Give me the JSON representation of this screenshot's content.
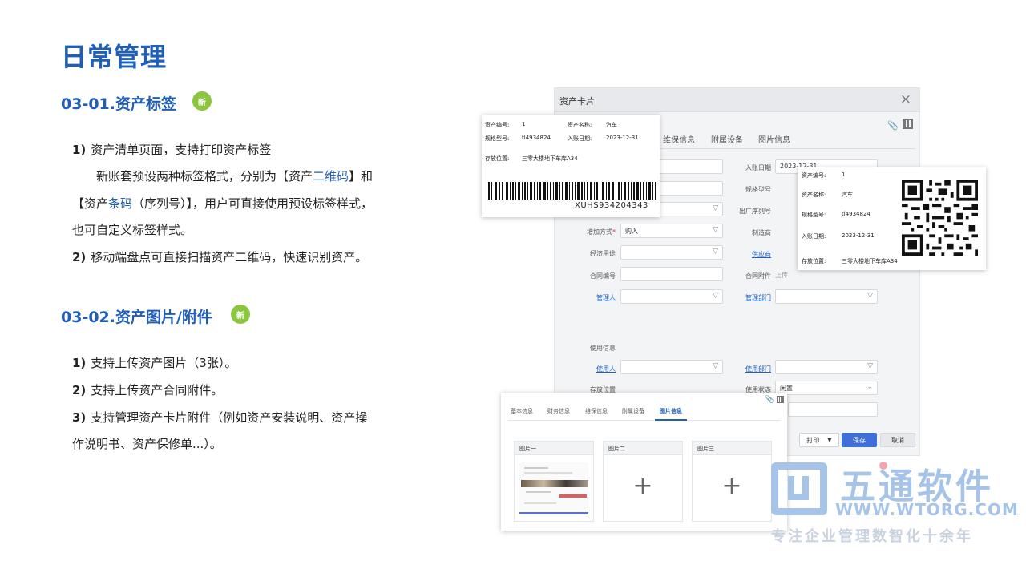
{
  "page": {
    "title": "日常管理",
    "sections": [
      {
        "title": "03-01.资产标签",
        "badge": "新",
        "lines": {
          "l1_num": "1)",
          "l1_text": "资产清单页面，支持打印资产标签",
          "l2_a": "新账套预设两种标签格式，分别为【资产",
          "l2_link": "二维码",
          "l2_b": "】和",
          "l3_a": "【资产",
          "l3_link": "条码",
          "l3_b": "（序列号）】，用户可直接使用预设标签样式，",
          "l4": "也可自定义标签样式。",
          "l5_num": "2)",
          "l5_text": "移动端盘点可直接扫描资产二维码，快速识别资产。"
        }
      },
      {
        "title": "03-02.资产图片/附件",
        "badge": "新",
        "lines": {
          "l1_num": "1)",
          "l1_text": "支持上传资产图片（3张）。",
          "l2_num": "2)",
          "l2_text": "支持上传资产合同附件。",
          "l3_num": "3)",
          "l3_text": "支持管理资产卡片附件（例如资产安装说明、资产操",
          "l4": "作说明书、资产保修单...）。"
        }
      }
    ]
  },
  "dialog": {
    "title": "资产卡片",
    "close": "×",
    "tabs": [
      "维保信息",
      "附属设备",
      "图片信息"
    ],
    "fields": {
      "entry_date_label": "入账日期",
      "entry_date_value": "2023-12-31",
      "spec_label": "规格型号",
      "serial_label": "出厂序列号",
      "add_method_label": "增加方式",
      "add_method_value": "购入",
      "maker_label": "制造商",
      "econ_use_label": "经济用途",
      "supplier_label": "供应商",
      "contract_no_label": "合同编号",
      "contract_attach_label": "合同附件",
      "upload": "上传",
      "manager_label": "管理人",
      "mgmt_dept_label": "管理部门",
      "usage_section": "使用信息",
      "user_label": "使用人",
      "use_dept_label": "使用部门",
      "location_label": "存放位置",
      "use_status_label": "使用状态",
      "use_status_value": "闲置"
    },
    "buttons": {
      "print": "打印",
      "save": "保存",
      "cancel": "取消"
    }
  },
  "barcode_label": {
    "asset_no_label": "资产编号:",
    "asset_no_value": "1",
    "asset_name_label": "资产名称:",
    "asset_name_value": "汽车",
    "spec_label": "规格型号:",
    "spec_value": "tl4934824",
    "date_label": "入账日期:",
    "date_value": "2023-12-31",
    "location_label": "存放位置:",
    "location_value": "三零大楼地下车库A34",
    "barcode_text": "XUHS934204343"
  },
  "qr_label": {
    "asset_no_label": "资产编号:",
    "asset_no_value": "1",
    "asset_name_label": "资产名称:",
    "asset_name_value": "汽车",
    "spec_label": "规格型号:",
    "spec_value": "tl4934824",
    "date_label": "入账日期:",
    "date_value": "2023-12-31",
    "location_label": "存放位置:",
    "location_value": "三零大楼地下车库A34"
  },
  "photo_panel": {
    "tabs": [
      "基本信息",
      "财务信息",
      "维保信息",
      "附属设备",
      "图片信息"
    ],
    "active_tab": "图片信息",
    "slots": [
      "图片一",
      "图片二",
      "图片三"
    ],
    "plus": "+"
  },
  "logo": {
    "name": "五通软件",
    "url": "WWW.WTORG.COM",
    "slogan": "专注企业管理数智化十余年",
    "color": "#a6c3e8"
  }
}
